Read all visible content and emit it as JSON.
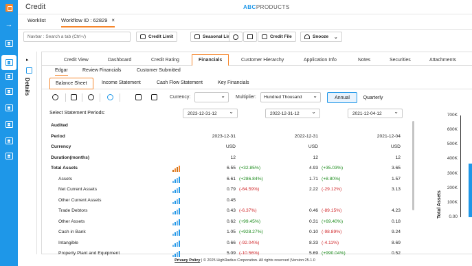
{
  "app": {
    "title": "Credit",
    "brand_prefix": "ABC",
    "brand_suffix": "PRODUCTS"
  },
  "tabs": {
    "worklist": "Worklist",
    "workflow": "Workflow ID : 62829",
    "close": "×"
  },
  "toolbar": {
    "navbar_placeholder": "Navbar : Search a tab (Ctrl+/)",
    "credit_limit": "Credit Limit",
    "seasonal_limit": "Seasonal Limit",
    "credit_file": "Credit File",
    "snooze": "Snooze"
  },
  "details": {
    "label": "Details"
  },
  "financial_tabs": [
    "Credit View",
    "Dashboard",
    "Credit Rating",
    "Financials",
    "Customer Hierarchy",
    "Application Info",
    "Notes",
    "Securities",
    "Attachments"
  ],
  "source_tabs": [
    "Edgar",
    "Review Financials",
    "Customer Submitted"
  ],
  "statement_tabs": [
    "Balance Sheet",
    "Income Statement",
    "Cash Flow Statement",
    "Key Financials"
  ],
  "controls": {
    "currency_label": "Currency:",
    "currency_value": "",
    "multiplier_label": "Multiplier:",
    "multiplier_value": "Hundred Thousand",
    "annual": "Annual",
    "quarterly": "Quarterly"
  },
  "periods": {
    "label": "Select Statement Periods:",
    "values": [
      "2023-12-31-12",
      "2022-12-31-12",
      "2021-12-04-12"
    ]
  },
  "table": {
    "audited": "Audited",
    "period_label": "Period",
    "period_values": [
      "2023-12-31",
      "2022-12-31",
      "2021-12-04"
    ],
    "currency_label": "Currency",
    "currency_values": [
      "USD",
      "USD",
      "USD"
    ],
    "duration_label": "Duration(months)",
    "duration_values": [
      "12",
      "12",
      "12"
    ],
    "rows": [
      {
        "label": "Total Assets",
        "bold": true,
        "v1": "6.55",
        "c1": "(+32.85%)",
        "v2": "4.93",
        "c2": "(+35.03%)",
        "v3": "3.65"
      },
      {
        "label": "Assets",
        "v1": "6.61",
        "c1": "(+286.84%)",
        "v2": "1.71",
        "c2": "(+8.80%)",
        "v3": "1.57"
      },
      {
        "label": "Net Current Assets",
        "v1": "0.79",
        "c1": "(-64.59%)",
        "v2": "2.22",
        "c2": "(-29.12%)",
        "v3": "3.13"
      },
      {
        "label": "Other Current Assets",
        "v1": "0.45",
        "c1": "",
        "v2": "",
        "c2": "",
        "v3": ""
      },
      {
        "label": "Trade Debtors",
        "v1": "0.43",
        "c1": "(-6.37%)",
        "v2": "0.46",
        "c2": "(-89.15%)",
        "v3": "4.23"
      },
      {
        "label": "Other Assets",
        "v1": "0.62",
        "c1": "(+99.45%)",
        "v2": "0.31",
        "c2": "(+69.40%)",
        "v3": "0.18"
      },
      {
        "label": "Cash in Bank",
        "v1": "1.05",
        "c1": "(+928.27%)",
        "v2": "0.10",
        "c2": "(-98.89%)",
        "v3": "9.24"
      },
      {
        "label": "Intangible",
        "v1": "0.66",
        "c1": "(-92.04%)",
        "v2": "8.33",
        "c2": "(-4.11%)",
        "v3": "8.69"
      },
      {
        "label": "Property Plant and Equipment",
        "v1": "5.09",
        "c1": "(-10.56%)",
        "v2": "5.69",
        "c2": "(+990.04%)",
        "v3": "0.52"
      }
    ]
  },
  "chart": {
    "ylabel": "Total Assets",
    "ticks": [
      "700K",
      "600K",
      "500K",
      "400K",
      "300K",
      "200K",
      "100K",
      "0.00"
    ],
    "bar_value": 370000,
    "ymax": 700000,
    "color": "#1e97e8"
  },
  "footer": {
    "link": "Privacy Policy",
    "text": " | © 2025 HighRadius Corporation. All rights reserved |Version:25.1.0"
  },
  "colors": {
    "accent": "#f6862b",
    "primary": "#1e97e8",
    "negative": "#d0272a",
    "positive": "#1a8a1a"
  }
}
